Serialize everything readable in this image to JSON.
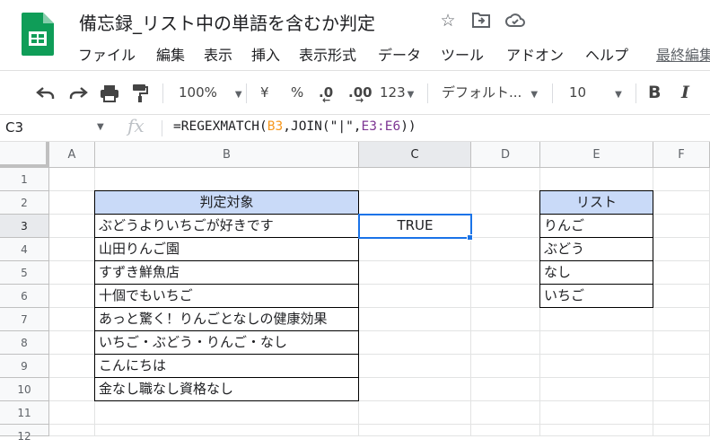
{
  "app": {
    "doc_title": "備忘録_リスト中の単語を含むか判定",
    "menu": [
      "ファイル",
      "編集",
      "表示",
      "挿入",
      "表示形式",
      "データ",
      "ツール",
      "アドオン",
      "ヘルプ"
    ],
    "last_edit": "最終編集",
    "brand_color": "#0f9d58"
  },
  "toolbar": {
    "zoom": "100%",
    "currency": "¥",
    "percent": "%",
    "dec_decrease": ".0",
    "dec_increase": ".00",
    "more_formats": "123",
    "font": "デフォルト...",
    "font_size": "10",
    "bold": "B",
    "italic": "I"
  },
  "formula_bar": {
    "cell_ref": "C3",
    "fx": "fx",
    "formula_prefix": "=REGEXMATCH(",
    "ref1": "B3",
    "formula_mid": ",JOIN(\"|\",",
    "ref2": "E3:E6",
    "formula_suffix": "))"
  },
  "sheet": {
    "columns": [
      "A",
      "B",
      "C",
      "D",
      "E",
      "F"
    ],
    "rows": [
      "1",
      "2",
      "3",
      "4",
      "5",
      "6",
      "7",
      "8",
      "9",
      "10",
      "11",
      "12"
    ],
    "b_header": "判定対象",
    "b_values": [
      "ぶどうよりいちごが好きです",
      "山田りんご園",
      "すずき鮮魚店",
      "十個でもいちご",
      "あっと驚く！りんごとなしの健康効果",
      "いちご・ぶどう・りんご・なし",
      "こんにちは",
      "金なし職なし資格なし"
    ],
    "c3_value": "TRUE",
    "e_header": "リスト",
    "e_values": [
      "りんご",
      "ぶどう",
      "なし",
      "いちご"
    ],
    "header_fill": "#c9daf8",
    "selection_color": "#1a73e8"
  }
}
